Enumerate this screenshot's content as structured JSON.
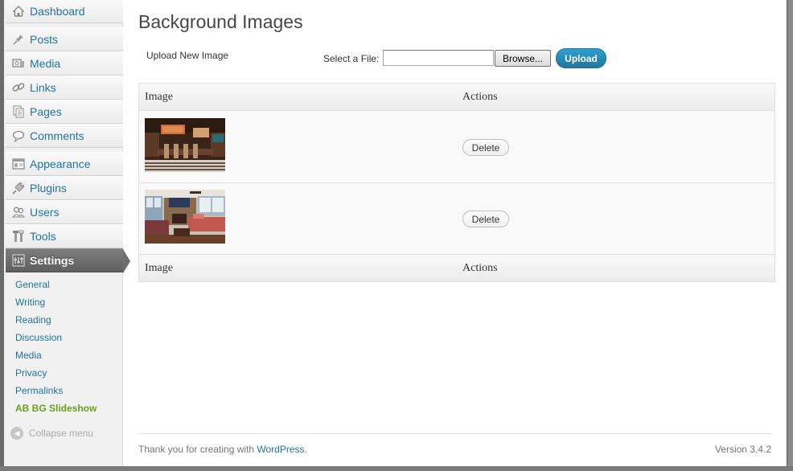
{
  "sidebar": {
    "menu": [
      {
        "label": "Dashboard",
        "icon": "home-icon"
      },
      {
        "label": "Posts",
        "icon": "pin-icon"
      },
      {
        "label": "Media",
        "icon": "media-icon"
      },
      {
        "label": "Links",
        "icon": "link-icon"
      },
      {
        "label": "Pages",
        "icon": "pages-icon"
      },
      {
        "label": "Comments",
        "icon": "comment-icon"
      },
      {
        "label": "Appearance",
        "icon": "appearance-icon"
      },
      {
        "label": "Plugins",
        "icon": "plug-icon"
      },
      {
        "label": "Users",
        "icon": "users-icon"
      },
      {
        "label": "Tools",
        "icon": "tools-icon"
      },
      {
        "label": "Settings",
        "icon": "settings-icon"
      }
    ],
    "submenu": [
      {
        "label": "General"
      },
      {
        "label": "Writing"
      },
      {
        "label": "Reading"
      },
      {
        "label": "Discussion"
      },
      {
        "label": "Media"
      },
      {
        "label": "Privacy"
      },
      {
        "label": "Permalinks"
      },
      {
        "label": "AB BG Slideshow"
      }
    ],
    "collapse_label": "Collapse menu"
  },
  "main": {
    "title": "Background Images",
    "upload_new_label": "Upload New Image",
    "select_file_label": "Select a File:",
    "file_value": "",
    "browse_label": "Browse...",
    "upload_label": "Upload",
    "table": {
      "headers": [
        "Image",
        "Actions"
      ],
      "footers": [
        "Image",
        "Actions"
      ],
      "rows": [
        {
          "image": "dining-room-thumbnail",
          "action": "Delete"
        },
        {
          "image": "living-room-thumbnail",
          "action": "Delete"
        }
      ]
    }
  },
  "footer": {
    "thanks_prefix": "Thank you for creating with ",
    "thanks_link": "WordPress",
    "thanks_suffix": ".",
    "version": "Version 3.4.2"
  },
  "colors": {
    "link": "#21759b",
    "active_submenu": "#6c9d1f",
    "primary_button": "#21759b"
  }
}
